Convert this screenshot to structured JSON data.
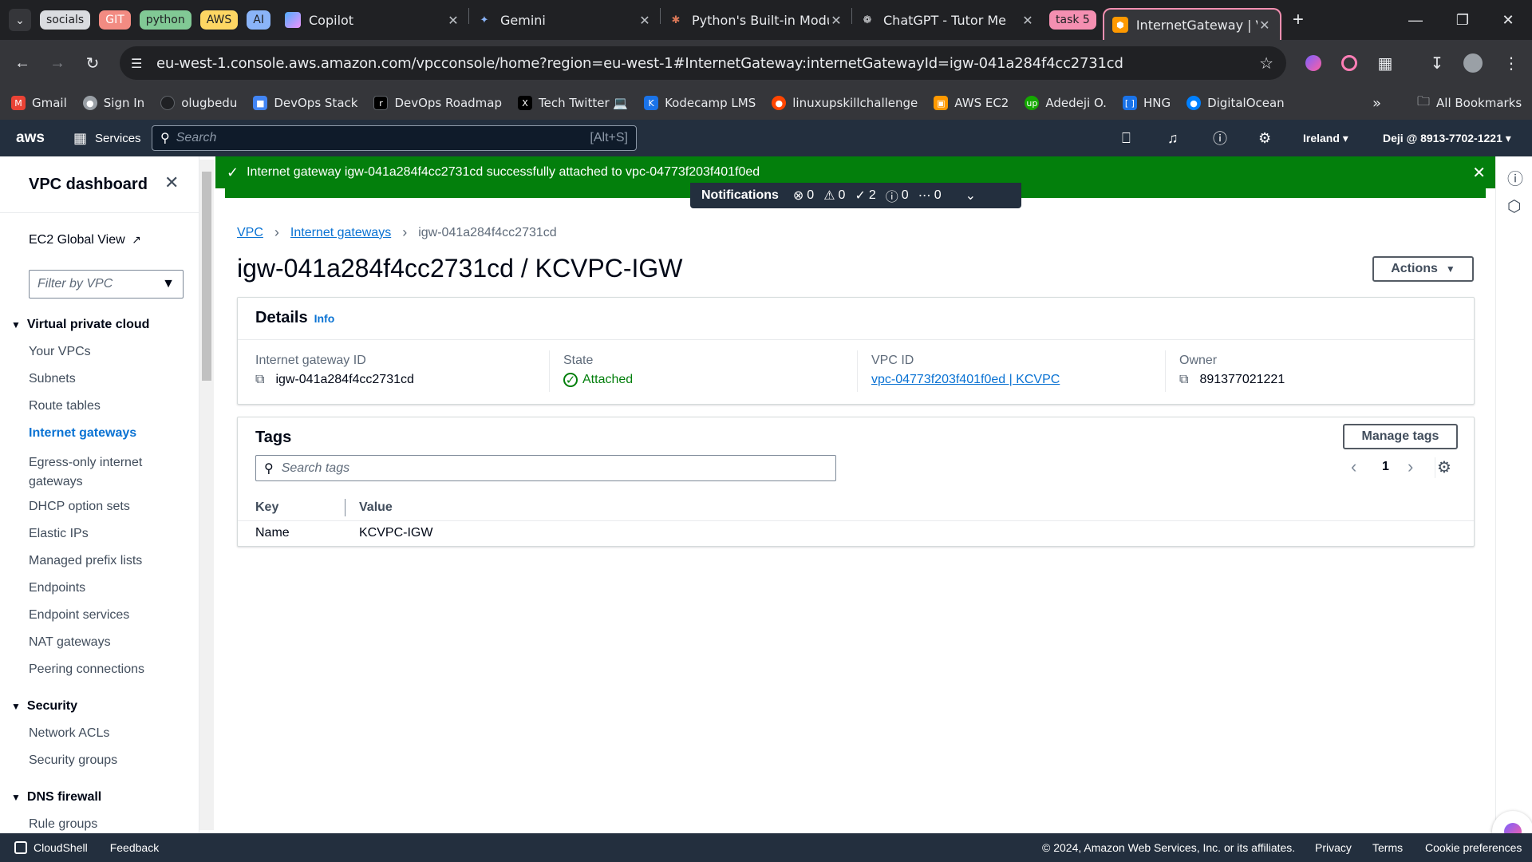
{
  "browser": {
    "tab_groups": [
      {
        "label": "socials",
        "color": "#dadce0"
      },
      {
        "label": "GIT",
        "color": "#f28b82"
      },
      {
        "label": "python",
        "color": "#81c995"
      },
      {
        "label": "AWS",
        "color": "#fdd663"
      },
      {
        "label": "AI",
        "color": "#8ab4f8"
      }
    ],
    "tabs": [
      {
        "title": "Copilot",
        "icon": "copilot-icon"
      },
      {
        "title": "Gemini",
        "icon": "gemini-icon"
      },
      {
        "title": "Python's Built-in Modu",
        "icon": "claude-icon"
      },
      {
        "title": "ChatGPT - Tutor Me",
        "icon": "chatgpt-icon"
      }
    ],
    "group_task": {
      "label": "task 5",
      "color": "#f48fb1"
    },
    "active_tab": {
      "title": "InternetGateway | VPC",
      "icon": "aws-icon"
    },
    "url": "eu-west-1.console.aws.amazon.com/vpcconsole/home?region=eu-west-1#InternetGateway:internetGatewayId=igw-041a284f4cc2731cd",
    "bookmarks": [
      {
        "label": "Gmail",
        "icon": "gmail-icon",
        "color": "#ea4335"
      },
      {
        "label": "Sign In",
        "icon": "signin-icon",
        "color": "#9aa0a6"
      },
      {
        "label": "olugbedu",
        "icon": "github-icon",
        "color": "#202124"
      },
      {
        "label": "DevOps Stack",
        "icon": "devops-stack-icon",
        "color": "#4285f4"
      },
      {
        "label": "DevOps Roadmap",
        "icon": "roadmap-icon",
        "color": "#000000"
      },
      {
        "label": "Tech Twitter 💻",
        "icon": "x-icon",
        "color": "#000000"
      },
      {
        "label": "Kodecamp LMS",
        "icon": "kodecamp-icon",
        "color": "#1a73e8"
      },
      {
        "label": "linuxupskillchallenge",
        "icon": "reddit-icon",
        "color": "#ff4500"
      },
      {
        "label": "AWS EC2",
        "icon": "aws-ec2-icon",
        "color": "#ff9900"
      },
      {
        "label": "Adedeji O.",
        "icon": "upwork-icon",
        "color": "#14a800"
      },
      {
        "label": "HNG",
        "icon": "hng-icon",
        "color": "#1a73e8"
      },
      {
        "label": "DigitalOcean",
        "icon": "digitalocean-icon",
        "color": "#0080ff"
      }
    ],
    "all_bookmarks": "All Bookmarks"
  },
  "aws": {
    "logo": "aws",
    "services": "Services",
    "search_placeholder": "Search",
    "search_shortcut": "[Alt+S]",
    "region": "Ireland",
    "account": "Deji @ 8913-7702-1221"
  },
  "sidebar": {
    "title": "VPC dashboard",
    "ec2_global_view": "EC2 Global View",
    "filter_placeholder": "Filter by VPC",
    "sections": [
      {
        "label": "Virtual private cloud",
        "items": [
          "Your VPCs",
          "Subnets",
          "Route tables",
          "Internet gateways",
          "Egress-only internet gateways",
          "DHCP option sets",
          "Elastic IPs",
          "Managed prefix lists",
          "Endpoints",
          "Endpoint services",
          "NAT gateways",
          "Peering connections"
        ]
      },
      {
        "label": "Security",
        "items": [
          "Network ACLs",
          "Security groups"
        ]
      },
      {
        "label": "DNS firewall",
        "items": [
          "Rule groups"
        ]
      }
    ],
    "active_item": "Internet gateways"
  },
  "flash": {
    "message": "Internet gateway igw-041a284f4cc2731cd successfully attached to vpc-04773f203f401f0ed"
  },
  "notifications": {
    "label": "Notifications",
    "error": "0",
    "warning": "0",
    "success": "2",
    "info": "0",
    "in_progress": "0"
  },
  "breadcrumb": [
    "VPC",
    "Internet gateways",
    "igw-041a284f4cc2731cd"
  ],
  "page_title": "igw-041a284f4cc2731cd / KCVPC-IGW",
  "actions_label": "Actions",
  "details": {
    "heading": "Details",
    "info": "Info",
    "fields": [
      {
        "label": "Internet gateway ID",
        "value": "igw-041a284f4cc2731cd"
      },
      {
        "label": "State",
        "value": "Attached"
      },
      {
        "label": "VPC ID",
        "value": "vpc-04773f203f401f0ed | KCVPC"
      },
      {
        "label": "Owner",
        "value": "891377021221"
      }
    ]
  },
  "tags": {
    "heading": "Tags",
    "manage_label": "Manage tags",
    "search_placeholder": "Search tags",
    "page": "1",
    "columns": [
      "Key",
      "Value"
    ],
    "rows": [
      {
        "key": "Name",
        "value": "KCVPC-IGW"
      }
    ]
  },
  "footer": {
    "cloudshell": "CloudShell",
    "feedback": "Feedback",
    "copyright": "© 2024, Amazon Web Services, Inc. or its affiliates.",
    "privacy": "Privacy",
    "terms": "Terms",
    "cookie": "Cookie preferences"
  }
}
